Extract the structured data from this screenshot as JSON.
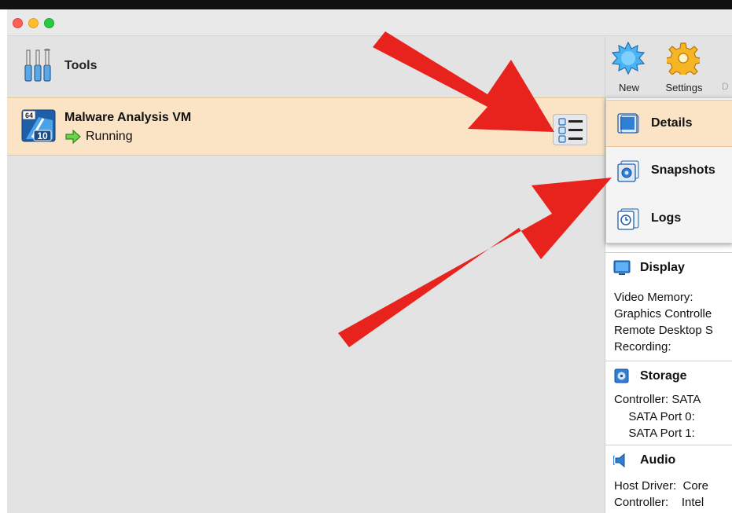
{
  "sidebar": {
    "tools_label": "Tools",
    "vm": {
      "name": "Malware Analysis VM",
      "status": "Running",
      "os_badge_top": "64",
      "os_badge_bottom": "10"
    }
  },
  "toolbar": {
    "new_label": "New",
    "settings_label": "Settings",
    "truncated_label": "D"
  },
  "tool_menu": {
    "items": [
      {
        "label": "Details",
        "selected": true
      },
      {
        "label": "Snapshots",
        "selected": false
      },
      {
        "label": "Logs",
        "selected": false
      }
    ]
  },
  "details": {
    "display": {
      "title": "Display",
      "lines": [
        "Video Memory:",
        "Graphics Controlle",
        "Remote Desktop S",
        "Recording:"
      ]
    },
    "storage": {
      "title": "Storage",
      "lines": [
        "Controller: SATA",
        "  SATA Port 0:",
        "  SATA Port 1:"
      ]
    },
    "audio": {
      "title": "Audio",
      "lines": [
        "Host Driver:  Core",
        "Controller:    Intel"
      ]
    }
  },
  "colors": {
    "selection": "#fbe4c6",
    "arrow": "#e8231d",
    "running": "#3dbb2f"
  }
}
